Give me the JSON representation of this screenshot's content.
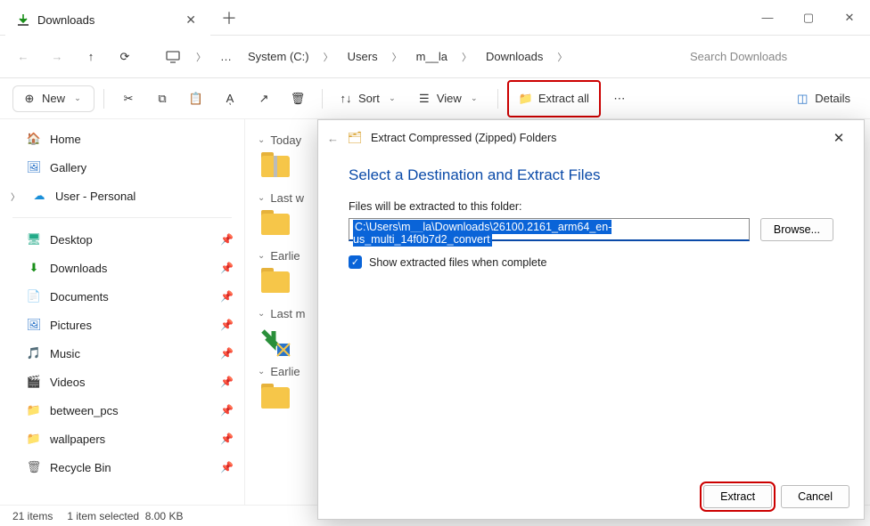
{
  "window": {
    "title": "Downloads"
  },
  "breadcrumbs": [
    "System (C:)",
    "Users",
    "m__la",
    "Downloads"
  ],
  "search": {
    "placeholder": "Search Downloads"
  },
  "toolbar": {
    "new": "New",
    "sort": "Sort",
    "view": "View",
    "extract_all": "Extract all",
    "details": "Details"
  },
  "nav_top": [
    {
      "label": "Home",
      "icon": "home-icon"
    },
    {
      "label": "Gallery",
      "icon": "gallery-icon"
    },
    {
      "label": "User - Personal",
      "icon": "onedrive-icon",
      "expandable": true
    }
  ],
  "nav_pinned": [
    {
      "label": "Desktop",
      "icon": "desktop-icon"
    },
    {
      "label": "Downloads",
      "icon": "downloads-icon"
    },
    {
      "label": "Documents",
      "icon": "documents-icon"
    },
    {
      "label": "Pictures",
      "icon": "pictures-icon"
    },
    {
      "label": "Music",
      "icon": "music-icon"
    },
    {
      "label": "Videos",
      "icon": "videos-icon"
    },
    {
      "label": "between_pcs",
      "icon": "folder-icon"
    },
    {
      "label": "wallpapers",
      "icon": "folder-icon"
    },
    {
      "label": "Recycle Bin",
      "icon": "recycle-icon"
    }
  ],
  "groups": [
    "Today",
    "Last w",
    "Earlie",
    "Last m",
    "Earlie"
  ],
  "dialog": {
    "title": "Extract Compressed (Zipped) Folders",
    "heading": "Select a Destination and Extract Files",
    "label": "Files will be extracted to this folder:",
    "path": "C:\\Users\\m__la\\Downloads\\26100.2161_arm64_en-us_multi_14f0b7d2_convert",
    "browse": "Browse...",
    "checkbox": "Show extracted files when complete",
    "extract": "Extract",
    "cancel": "Cancel"
  },
  "status": {
    "items": "21 items",
    "selected": "1 item selected",
    "size": "8.00 KB"
  }
}
